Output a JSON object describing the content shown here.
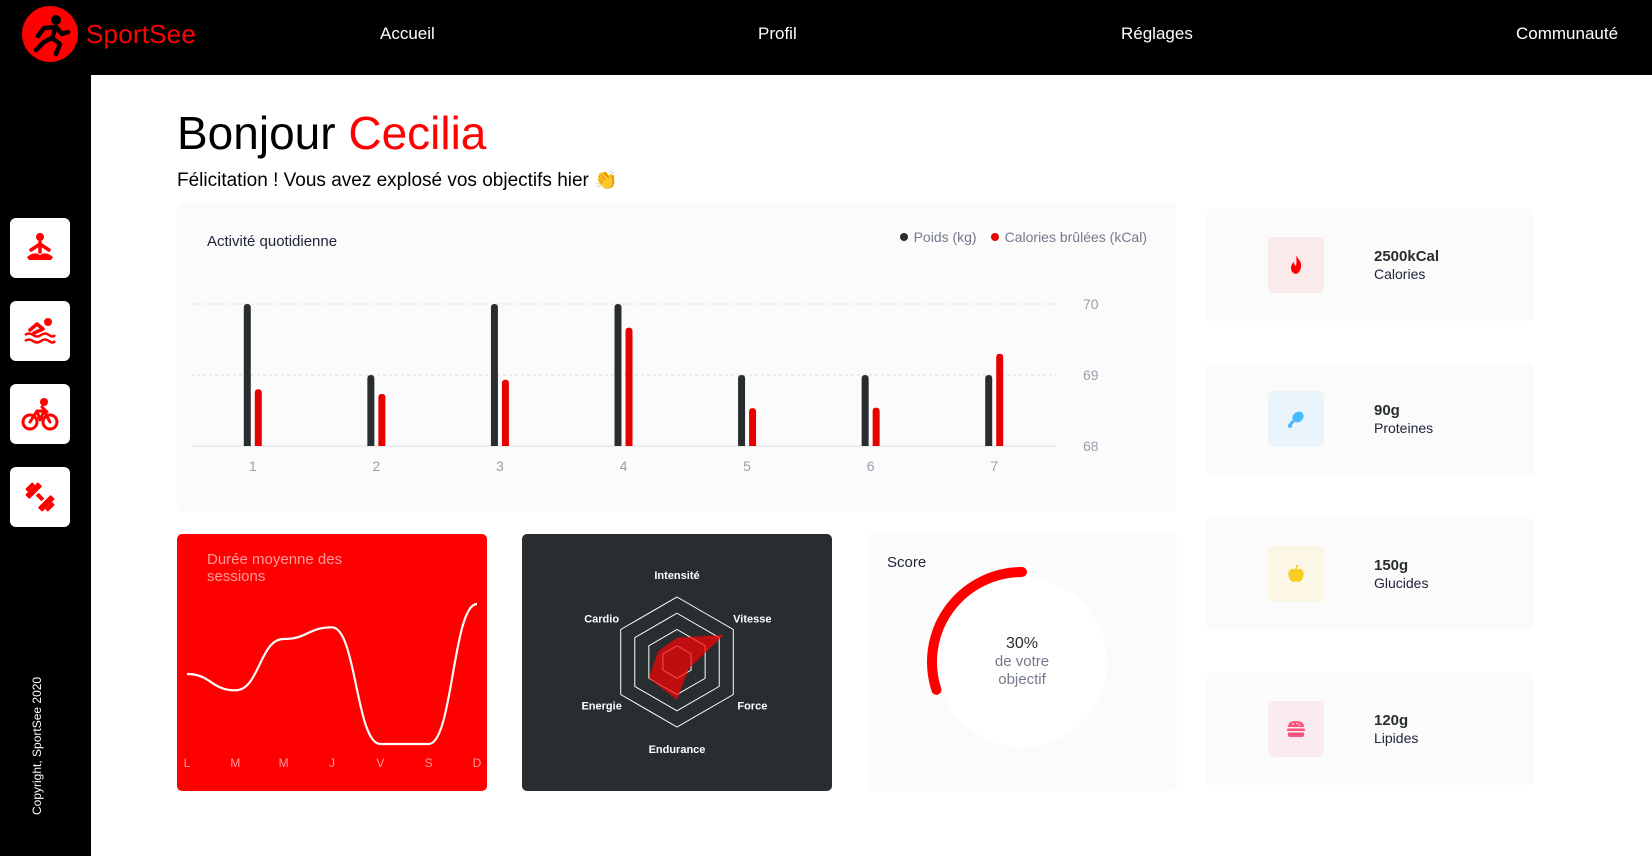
{
  "brand": {
    "name": "SportSee",
    "accent": "#FF0101"
  },
  "nav": {
    "home": "Accueil",
    "profile": "Profil",
    "settings": "Réglages",
    "community": "Communauté"
  },
  "sidebar": {
    "icons": [
      "yoga-icon",
      "swimming-icon",
      "cycling-icon",
      "dumbbell-icon"
    ],
    "copyright": "Copyright, SportSee 2020"
  },
  "header": {
    "greeting": "Bonjour",
    "name": "Cecilia",
    "message": "Félicitation ! Vous avez explosé vos objectifs hier 👏"
  },
  "activity": {
    "title": "Activité quotidienne",
    "legend_weight": "Poids (kg)",
    "legend_calories": "Calories brûlées (kCal)"
  },
  "sessions": {
    "title": "Durée moyenne des sessions"
  },
  "performance": {},
  "score": {
    "title": "Score",
    "percent": "30%",
    "line1": "de votre",
    "line2": "objectif"
  },
  "keydata": [
    {
      "value": "2500kCal",
      "label": "Calories",
      "icon": "fire-icon",
      "color": "#FF0000",
      "bg": "#FBEAEA"
    },
    {
      "value": "90g",
      "label": "Proteines",
      "icon": "chicken-icon",
      "color": "#4AB8FF",
      "bg": "#E9F4FB"
    },
    {
      "value": "150g",
      "label": "Glucides",
      "icon": "apple-icon",
      "color": "#F9CE23",
      "bg": "#FBF6E5"
    },
    {
      "value": "120g",
      "label": "Lipides",
      "icon": "burger-icon",
      "color": "#FD5181",
      "bg": "#FBEAEF"
    }
  ],
  "chart_data": [
    {
      "type": "bar",
      "title": "Activité quotidienne",
      "categories": [
        "1",
        "2",
        "3",
        "4",
        "5",
        "6",
        "7"
      ],
      "series": [
        {
          "name": "Poids (kg)",
          "values": [
            70,
            69,
            70,
            70,
            69,
            69,
            69
          ],
          "color": "#282D30"
        },
        {
          "name": "Calories brûlées (kCal)",
          "values": [
            240,
            220,
            280,
            500,
            160,
            162,
            390
          ],
          "color": "#E60000"
        }
      ],
      "yticks": [
        "68",
        "69",
        "70"
      ],
      "ylim": [
        68,
        70
      ],
      "calories_range": [
        0,
        600
      ],
      "grid": "horizontal-dashed",
      "legend": "top-right"
    },
    {
      "type": "line",
      "title": "Durée moyenne des sessions",
      "categories": [
        "L",
        "M",
        "M",
        "J",
        "V",
        "S",
        "D"
      ],
      "values": [
        30,
        23,
        45,
        50,
        0,
        0,
        60
      ],
      "color": "#FFFFFF"
    },
    {
      "type": "radar",
      "categories": [
        "Intensité",
        "Vitesse",
        "Force",
        "Endurance",
        "Energie",
        "Cardio"
      ],
      "values": [
        90,
        200,
        50,
        140,
        120,
        80
      ],
      "max": 240,
      "color": "#FF0101"
    },
    {
      "type": "radial",
      "title": "Score",
      "value": 0.3,
      "color": "#FF0000"
    }
  ]
}
